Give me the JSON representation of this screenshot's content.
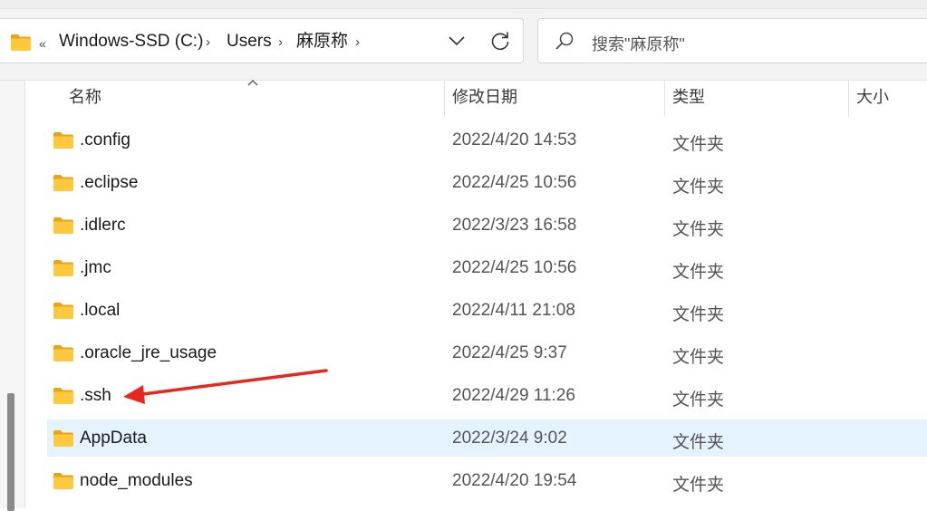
{
  "address": {
    "overflow_glyph": "«",
    "breadcrumbs": [
      "Windows-SSD (C:)",
      "Users",
      "麻原称"
    ],
    "separator": "›"
  },
  "search": {
    "placeholder": "搜索\"麻原称\""
  },
  "columns": {
    "name": "名称",
    "date": "修改日期",
    "type": "类型",
    "size": "大小"
  },
  "files": [
    {
      "name": ".config",
      "date": "2022/4/20 14:53",
      "type": "文件夹",
      "selected": false
    },
    {
      "name": ".eclipse",
      "date": "2022/4/25 10:56",
      "type": "文件夹",
      "selected": false
    },
    {
      "name": ".idlerc",
      "date": "2022/3/23 16:58",
      "type": "文件夹",
      "selected": false
    },
    {
      "name": ".jmc",
      "date": "2022/4/25 10:56",
      "type": "文件夹",
      "selected": false
    },
    {
      "name": ".local",
      "date": "2022/4/11 21:08",
      "type": "文件夹",
      "selected": false
    },
    {
      "name": ".oracle_jre_usage",
      "date": "2022/4/25 9:37",
      "type": "文件夹",
      "selected": false
    },
    {
      "name": ".ssh",
      "date": "2022/4/29 11:26",
      "type": "文件夹",
      "selected": false
    },
    {
      "name": "AppData",
      "date": "2022/3/24 9:02",
      "type": "文件夹",
      "selected": true
    },
    {
      "name": "node_modules",
      "date": "2022/4/20 19:54",
      "type": "文件夹",
      "selected": false
    }
  ],
  "colors": {
    "folder": "#ffc83d",
    "folder_dark": "#e8a317",
    "selection": "#e5f3ff",
    "annotation_arrow": "#e8261c"
  },
  "icons": {
    "folder": "folder-icon",
    "search": "search-icon",
    "refresh": "refresh-icon",
    "dropdown": "chevron-down-icon",
    "sort": "sort-caret-icon"
  }
}
